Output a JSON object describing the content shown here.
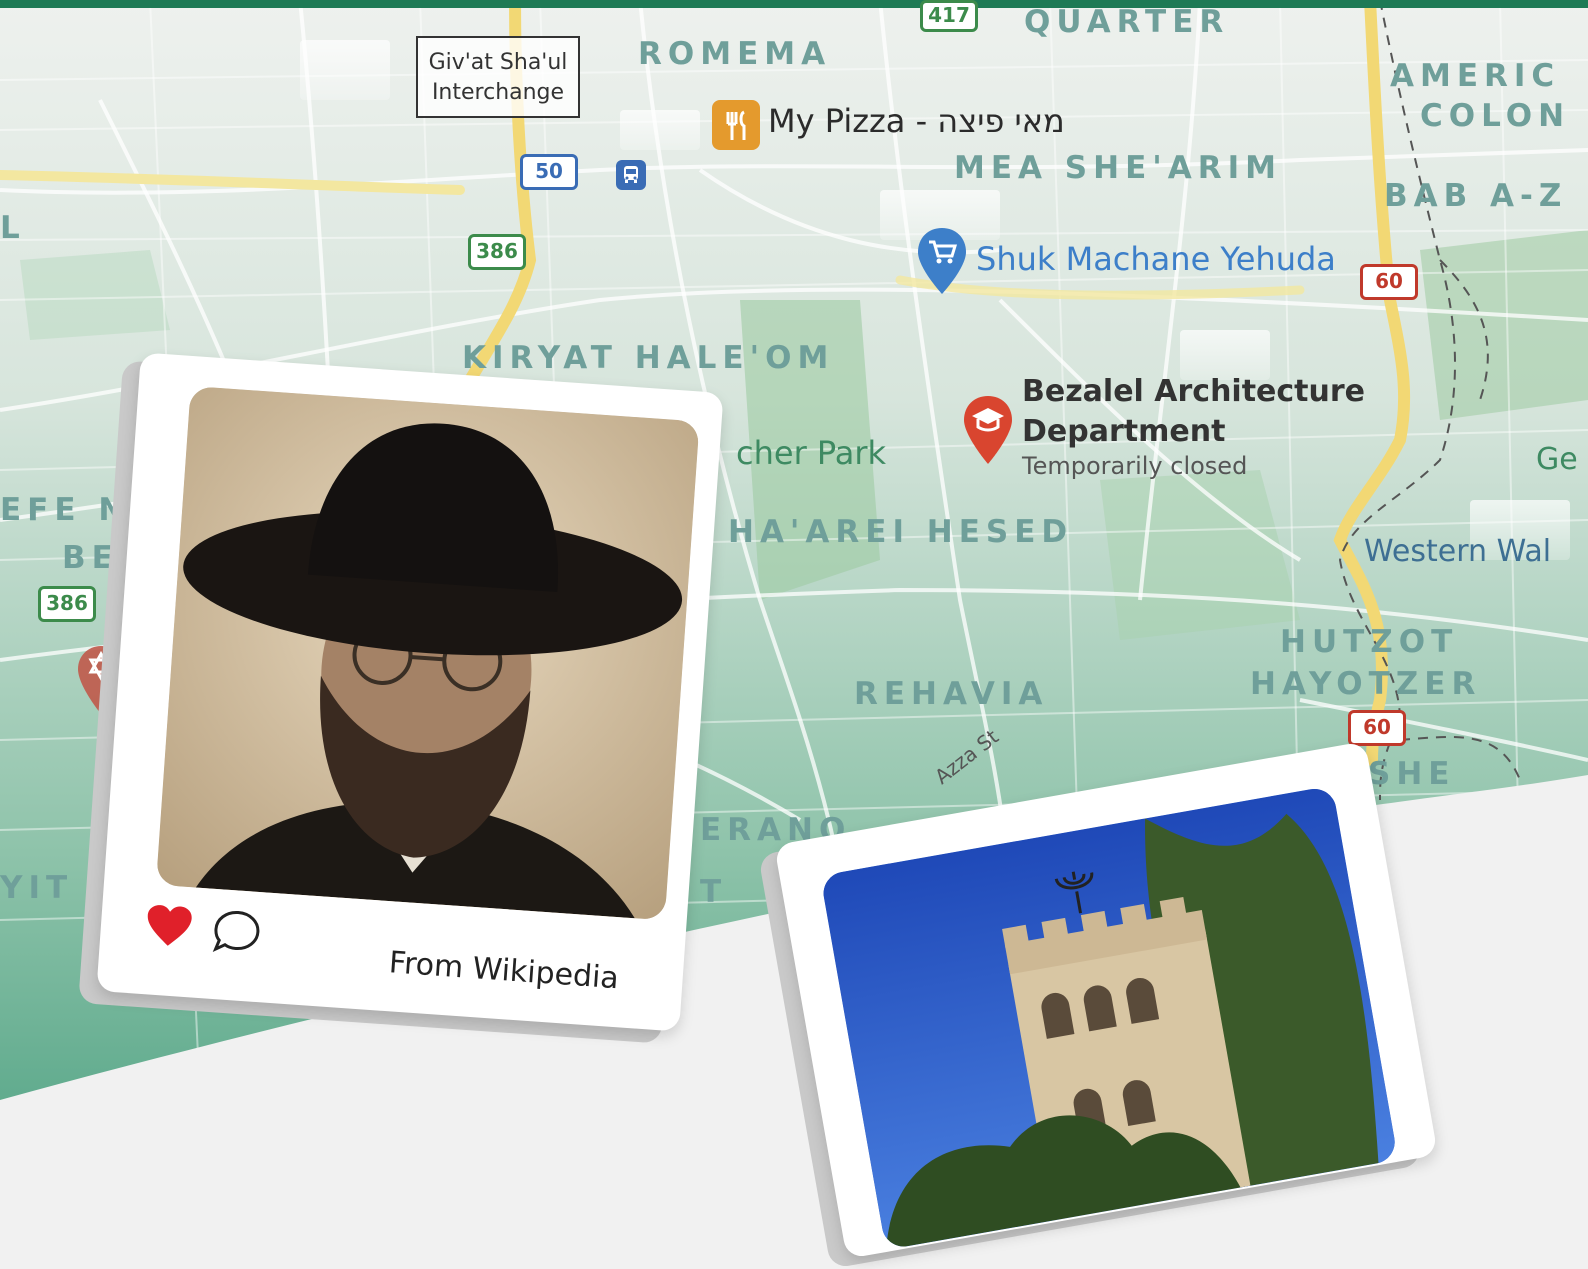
{
  "districts": {
    "quarter": "QUARTER",
    "romema": "ROMEMA",
    "american_colony_1": "AMERIC",
    "american_colony_2": "COLON",
    "mea_shearim": "MEA SHE'ARIM",
    "bab_az": "BAB A-Z",
    "kiryat_haleom": "KIRYAT HALE'OM",
    "yefe_nof_1": "EFE N",
    "yefe_nof_2": "BEI",
    "shaarei_hesed": "HA'AREI HESED",
    "rehavia": "REHAVIA",
    "hutzot_1": "HUTZOT",
    "hutzot_2": "HAYOTZER",
    "mishkenot": "SHE",
    "talbiyeh": "ERANO",
    "bayit_vegan": "YIT V",
    "edge_l": "L",
    "edge_t": "T"
  },
  "places": {
    "interchange_line1": "Giv'at Sha'ul",
    "interchange_line2": "Interchange",
    "my_pizza": "My Pizza - מאי פיצה",
    "shuk": "Shuk Machane Yehuda",
    "bezalel_line1": "Bezalel Architecture",
    "bezalel_line2": "Department",
    "bezalel_status": "Temporarily closed",
    "park": "cher Park",
    "western_wall": "Western Wal",
    "ge": "Ge",
    "azza_st": "Azza St"
  },
  "shields": {
    "r417": "417",
    "r50": "50",
    "r386a": "386",
    "r386b": "386",
    "r60a": "60",
    "r60b": "60"
  },
  "cards": {
    "portrait_caption": "From Wikipedia"
  },
  "colors": {
    "accent": "#1e7a55",
    "heart": "#e0202a",
    "map_top": "#e9eeeb",
    "map_bottom": "#5aa88a"
  }
}
